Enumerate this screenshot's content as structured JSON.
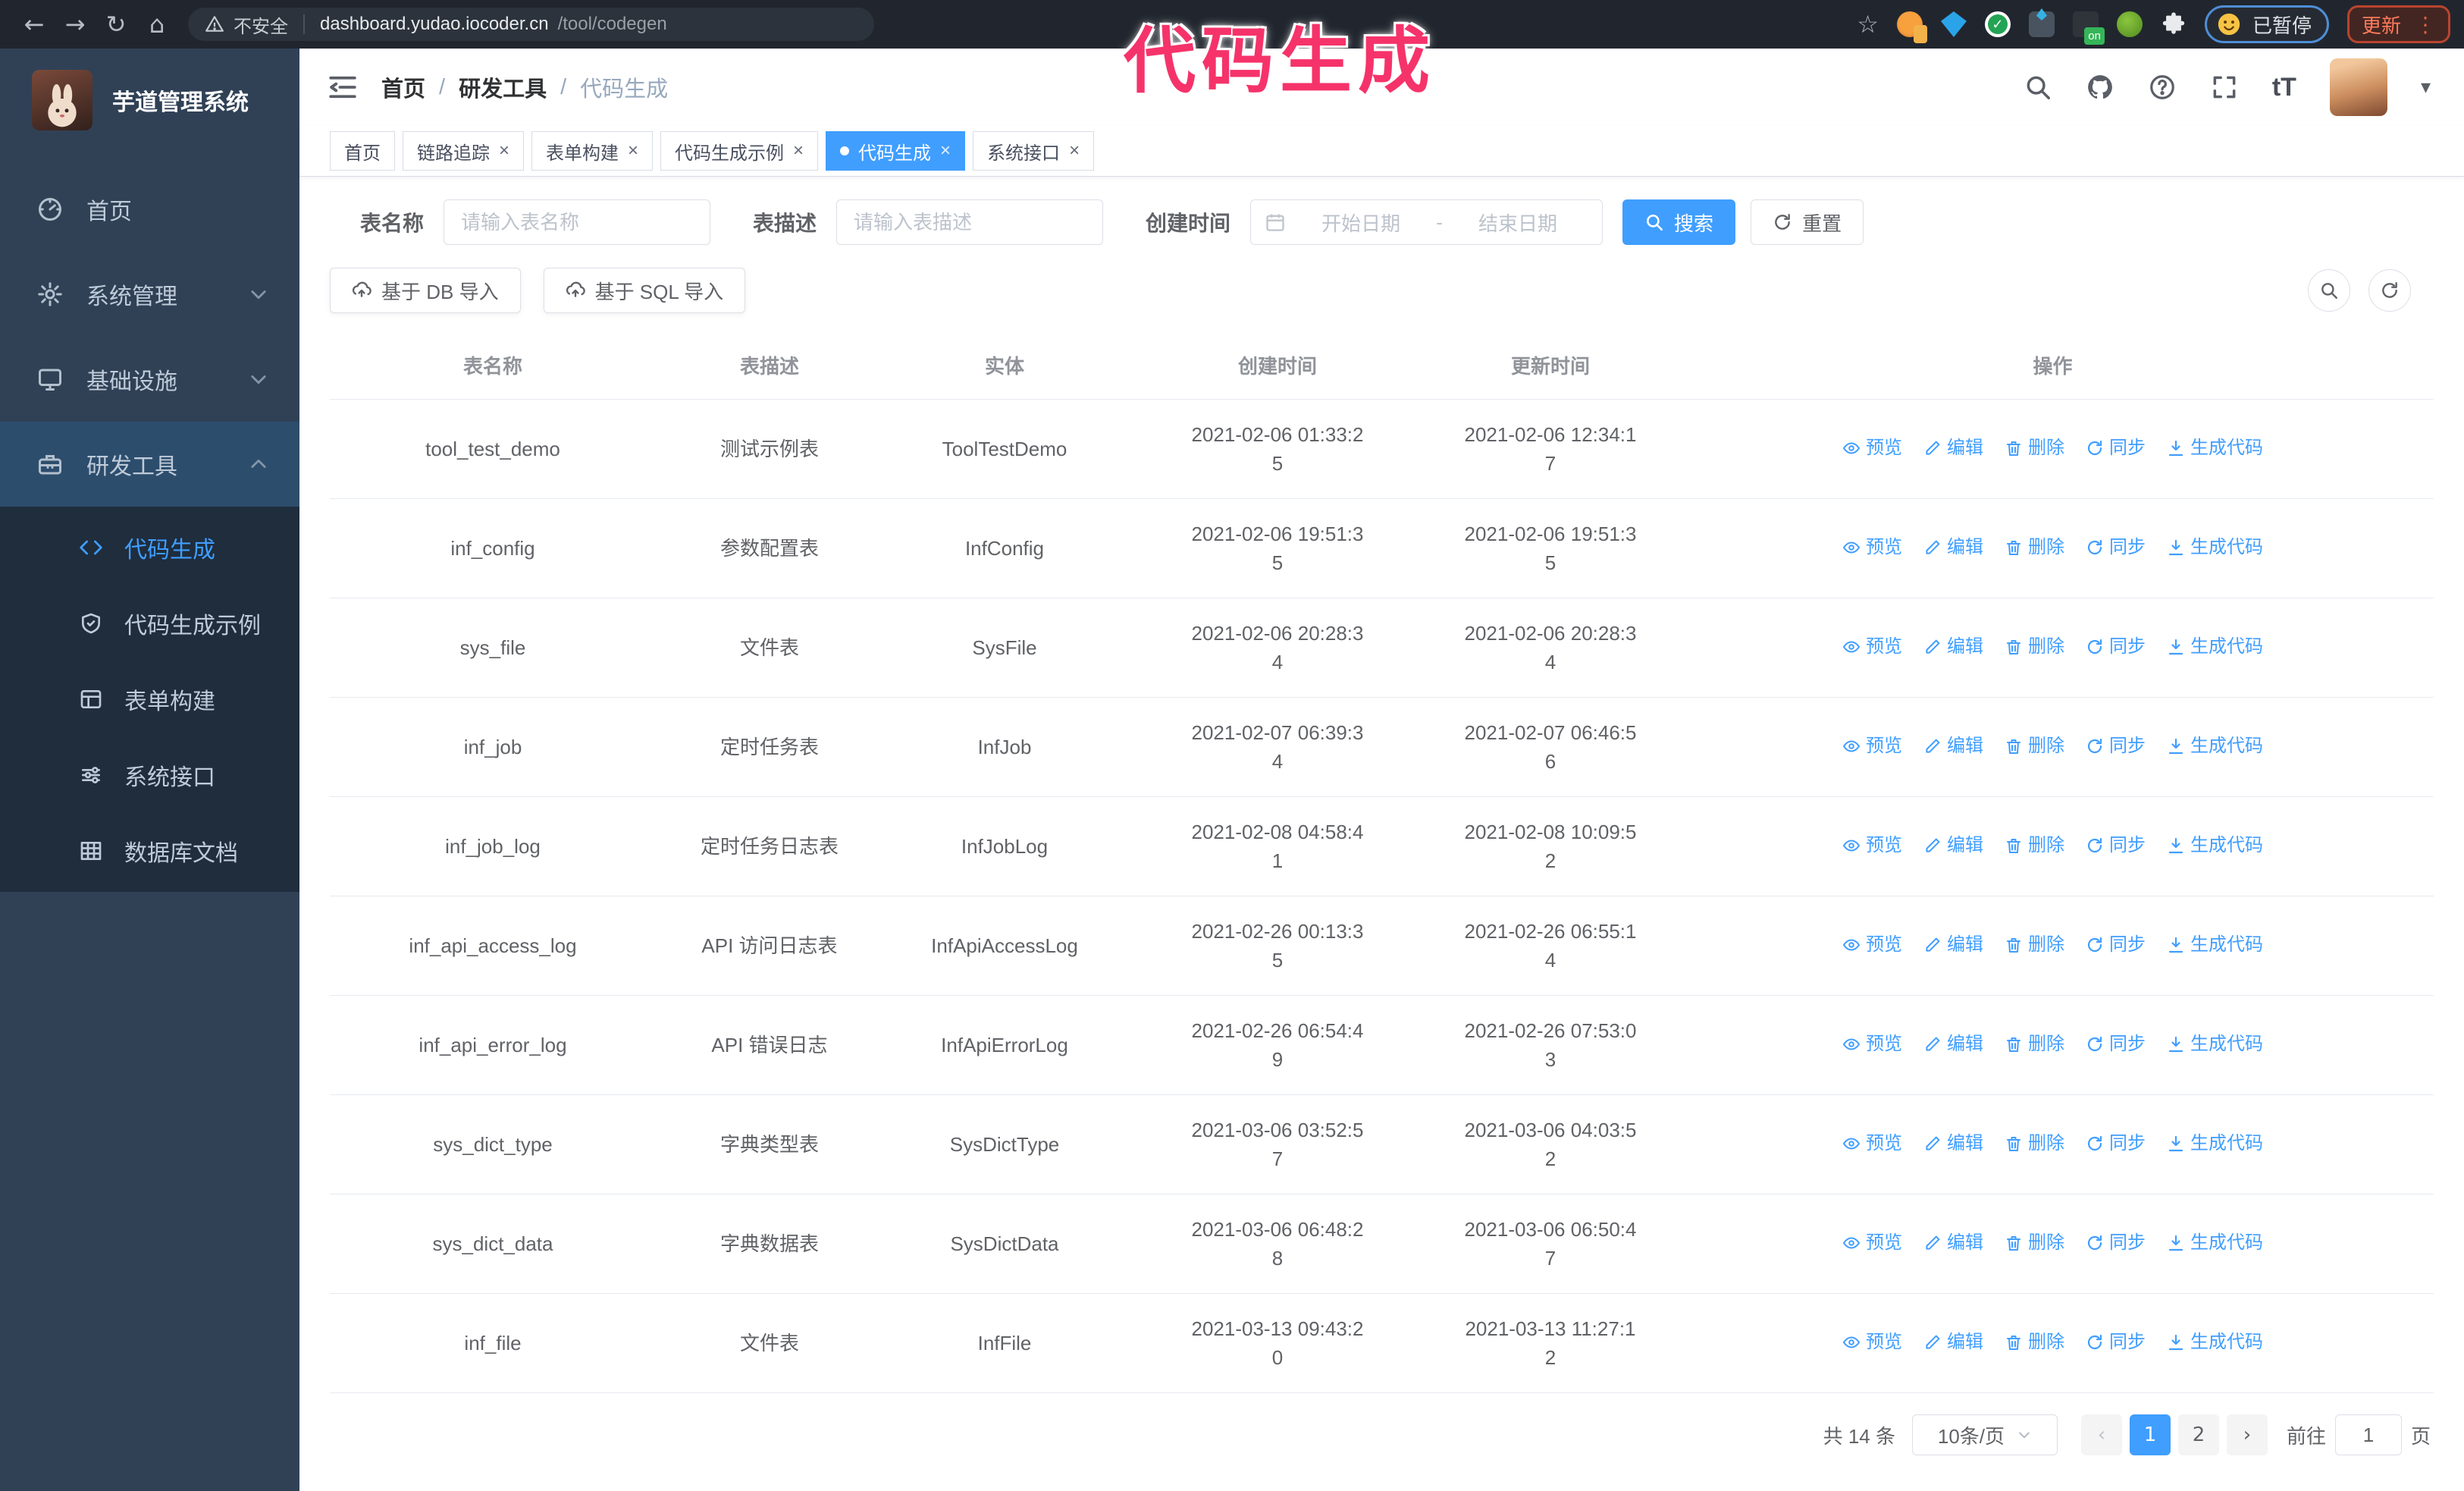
{
  "browser": {
    "security_label": "不安全",
    "url_host": "dashboard.yudao.iocoder.cn",
    "url_path": "/tool/codegen",
    "paused_label": "已暂停",
    "update_label": "更新",
    "ext_on_label": "on"
  },
  "icons": {
    "back": "←",
    "forward": "→",
    "reload": "↻",
    "home": "⌂",
    "star": "☆",
    "more_dots": "⋮",
    "caret": "▾",
    "text_size": "tT",
    "close": "×",
    "prev_arrow": "‹",
    "next_arrow": "›"
  },
  "annotation": {
    "text": "代码生成",
    "color": "#f5336a"
  },
  "sidebar": {
    "app_title": "芋道管理系统",
    "items": [
      {
        "label": "首页",
        "icon": "dashboard"
      },
      {
        "label": "系统管理",
        "icon": "gear",
        "trailing": "chevron-down"
      },
      {
        "label": "基础设施",
        "icon": "monitor",
        "trailing": "chevron-down"
      },
      {
        "label": "研发工具",
        "icon": "toolbox",
        "trailing": "chevron-up",
        "expanded": true
      }
    ],
    "submenu": [
      {
        "label": "代码生成",
        "icon": "code",
        "active": true
      },
      {
        "label": "代码生成示例",
        "icon": "shield-check",
        "active": false
      },
      {
        "label": "表单构建",
        "icon": "form",
        "active": false
      },
      {
        "label": "系统接口",
        "icon": "sliders",
        "active": false
      },
      {
        "label": "数据库文档",
        "icon": "table-grid",
        "active": false
      }
    ]
  },
  "header": {
    "breadcrumb": [
      "首页",
      "研发工具",
      "代码生成"
    ],
    "separator": "/"
  },
  "tabs": [
    {
      "label": "首页",
      "closable": false,
      "active": false
    },
    {
      "label": "链路追踪",
      "closable": true,
      "active": false
    },
    {
      "label": "表单构建",
      "closable": true,
      "active": false
    },
    {
      "label": "代码生成示例",
      "closable": true,
      "active": false
    },
    {
      "label": "代码生成",
      "closable": true,
      "active": true
    },
    {
      "label": "系统接口",
      "closable": true,
      "active": false
    }
  ],
  "search": {
    "name_label": "表名称",
    "name_placeholder": "请输入表名称",
    "desc_label": "表描述",
    "desc_placeholder": "请输入表描述",
    "time_label": "创建时间",
    "start_placeholder": "开始日期",
    "range_separator": "-",
    "end_placeholder": "结束日期",
    "search_button": "搜索",
    "reset_button": "重置"
  },
  "toolbar": {
    "db_import": "基于 DB 导入",
    "sql_import": "基于 SQL 导入"
  },
  "table": {
    "columns": [
      "表名称",
      "表描述",
      "实体",
      "创建时间",
      "更新时间",
      "操作"
    ],
    "actions": [
      "预览",
      "编辑",
      "删除",
      "同步",
      "生成代码"
    ],
    "rows": [
      {
        "name": "tool_test_demo",
        "desc": "测试示例表",
        "entity": "ToolTestDemo",
        "created": "2021-02-06 01:33:25",
        "updated": "2021-02-06 12:34:17"
      },
      {
        "name": "inf_config",
        "desc": "参数配置表",
        "entity": "InfConfig",
        "created": "2021-02-06 19:51:35",
        "updated": "2021-02-06 19:51:35"
      },
      {
        "name": "sys_file",
        "desc": "文件表",
        "entity": "SysFile",
        "created": "2021-02-06 20:28:34",
        "updated": "2021-02-06 20:28:34"
      },
      {
        "name": "inf_job",
        "desc": "定时任务表",
        "entity": "InfJob",
        "created": "2021-02-07 06:39:34",
        "updated": "2021-02-07 06:46:56"
      },
      {
        "name": "inf_job_log",
        "desc": "定时任务日志表",
        "entity": "InfJobLog",
        "created": "2021-02-08 04:58:41",
        "updated": "2021-02-08 10:09:52"
      },
      {
        "name": "inf_api_access_log",
        "desc": "API 访问日志表",
        "entity": "InfApiAccessLog",
        "created": "2021-02-26 00:13:35",
        "updated": "2021-02-26 06:55:14"
      },
      {
        "name": "inf_api_error_log",
        "desc": "API 错误日志",
        "entity": "InfApiErrorLog",
        "created": "2021-02-26 06:54:49",
        "updated": "2021-02-26 07:53:03"
      },
      {
        "name": "sys_dict_type",
        "desc": "字典类型表",
        "entity": "SysDictType",
        "created": "2021-03-06 03:52:57",
        "updated": "2021-03-06 04:03:52"
      },
      {
        "name": "sys_dict_data",
        "desc": "字典数据表",
        "entity": "SysDictData",
        "created": "2021-03-06 06:48:28",
        "updated": "2021-03-06 06:50:47"
      },
      {
        "name": "inf_file",
        "desc": "文件表",
        "entity": "InfFile",
        "created": "2021-03-13 09:43:20",
        "updated": "2021-03-13 11:27:12"
      }
    ]
  },
  "pagination": {
    "total_label": "共 14 条",
    "page_size_label": "10条/页",
    "pages": [
      "1",
      "2"
    ],
    "active_page": "1",
    "goto_label": "前往",
    "goto_value": "1",
    "page_unit": "页"
  },
  "colors": {
    "accent": "#409eff",
    "sidebar_bg": "#304156",
    "submenu_bg": "#1f2d3d",
    "sidebar_text": "#bfcbd9",
    "annotation": "#f5336a",
    "table_header_text": "#909399",
    "cell_text": "#606266"
  }
}
